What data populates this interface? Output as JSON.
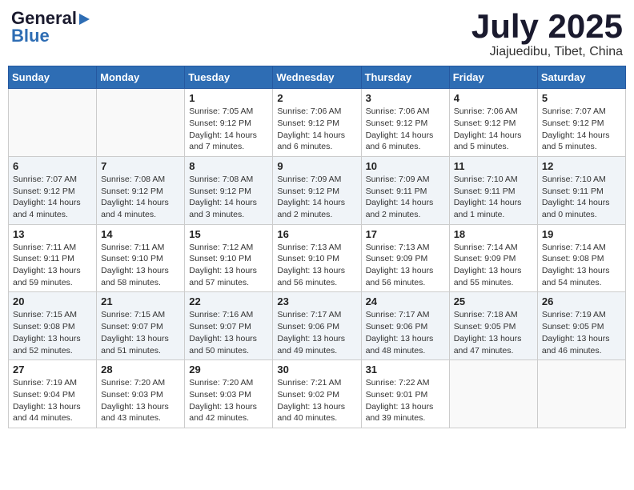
{
  "header": {
    "logo_general": "General",
    "logo_blue": "Blue",
    "month": "July 2025",
    "location": "Jiajuedibu, Tibet, China"
  },
  "days_of_week": [
    "Sunday",
    "Monday",
    "Tuesday",
    "Wednesday",
    "Thursday",
    "Friday",
    "Saturday"
  ],
  "weeks": [
    {
      "shaded": false,
      "days": [
        {
          "num": "",
          "info": ""
        },
        {
          "num": "",
          "info": ""
        },
        {
          "num": "1",
          "info": "Sunrise: 7:05 AM\nSunset: 9:12 PM\nDaylight: 14 hours and 7 minutes."
        },
        {
          "num": "2",
          "info": "Sunrise: 7:06 AM\nSunset: 9:12 PM\nDaylight: 14 hours and 6 minutes."
        },
        {
          "num": "3",
          "info": "Sunrise: 7:06 AM\nSunset: 9:12 PM\nDaylight: 14 hours and 6 minutes."
        },
        {
          "num": "4",
          "info": "Sunrise: 7:06 AM\nSunset: 9:12 PM\nDaylight: 14 hours and 5 minutes."
        },
        {
          "num": "5",
          "info": "Sunrise: 7:07 AM\nSunset: 9:12 PM\nDaylight: 14 hours and 5 minutes."
        }
      ]
    },
    {
      "shaded": true,
      "days": [
        {
          "num": "6",
          "info": "Sunrise: 7:07 AM\nSunset: 9:12 PM\nDaylight: 14 hours and 4 minutes."
        },
        {
          "num": "7",
          "info": "Sunrise: 7:08 AM\nSunset: 9:12 PM\nDaylight: 14 hours and 4 minutes."
        },
        {
          "num": "8",
          "info": "Sunrise: 7:08 AM\nSunset: 9:12 PM\nDaylight: 14 hours and 3 minutes."
        },
        {
          "num": "9",
          "info": "Sunrise: 7:09 AM\nSunset: 9:12 PM\nDaylight: 14 hours and 2 minutes."
        },
        {
          "num": "10",
          "info": "Sunrise: 7:09 AM\nSunset: 9:11 PM\nDaylight: 14 hours and 2 minutes."
        },
        {
          "num": "11",
          "info": "Sunrise: 7:10 AM\nSunset: 9:11 PM\nDaylight: 14 hours and 1 minute."
        },
        {
          "num": "12",
          "info": "Sunrise: 7:10 AM\nSunset: 9:11 PM\nDaylight: 14 hours and 0 minutes."
        }
      ]
    },
    {
      "shaded": false,
      "days": [
        {
          "num": "13",
          "info": "Sunrise: 7:11 AM\nSunset: 9:11 PM\nDaylight: 13 hours and 59 minutes."
        },
        {
          "num": "14",
          "info": "Sunrise: 7:11 AM\nSunset: 9:10 PM\nDaylight: 13 hours and 58 minutes."
        },
        {
          "num": "15",
          "info": "Sunrise: 7:12 AM\nSunset: 9:10 PM\nDaylight: 13 hours and 57 minutes."
        },
        {
          "num": "16",
          "info": "Sunrise: 7:13 AM\nSunset: 9:10 PM\nDaylight: 13 hours and 56 minutes."
        },
        {
          "num": "17",
          "info": "Sunrise: 7:13 AM\nSunset: 9:09 PM\nDaylight: 13 hours and 56 minutes."
        },
        {
          "num": "18",
          "info": "Sunrise: 7:14 AM\nSunset: 9:09 PM\nDaylight: 13 hours and 55 minutes."
        },
        {
          "num": "19",
          "info": "Sunrise: 7:14 AM\nSunset: 9:08 PM\nDaylight: 13 hours and 54 minutes."
        }
      ]
    },
    {
      "shaded": true,
      "days": [
        {
          "num": "20",
          "info": "Sunrise: 7:15 AM\nSunset: 9:08 PM\nDaylight: 13 hours and 52 minutes."
        },
        {
          "num": "21",
          "info": "Sunrise: 7:15 AM\nSunset: 9:07 PM\nDaylight: 13 hours and 51 minutes."
        },
        {
          "num": "22",
          "info": "Sunrise: 7:16 AM\nSunset: 9:07 PM\nDaylight: 13 hours and 50 minutes."
        },
        {
          "num": "23",
          "info": "Sunrise: 7:17 AM\nSunset: 9:06 PM\nDaylight: 13 hours and 49 minutes."
        },
        {
          "num": "24",
          "info": "Sunrise: 7:17 AM\nSunset: 9:06 PM\nDaylight: 13 hours and 48 minutes."
        },
        {
          "num": "25",
          "info": "Sunrise: 7:18 AM\nSunset: 9:05 PM\nDaylight: 13 hours and 47 minutes."
        },
        {
          "num": "26",
          "info": "Sunrise: 7:19 AM\nSunset: 9:05 PM\nDaylight: 13 hours and 46 minutes."
        }
      ]
    },
    {
      "shaded": false,
      "days": [
        {
          "num": "27",
          "info": "Sunrise: 7:19 AM\nSunset: 9:04 PM\nDaylight: 13 hours and 44 minutes."
        },
        {
          "num": "28",
          "info": "Sunrise: 7:20 AM\nSunset: 9:03 PM\nDaylight: 13 hours and 43 minutes."
        },
        {
          "num": "29",
          "info": "Sunrise: 7:20 AM\nSunset: 9:03 PM\nDaylight: 13 hours and 42 minutes."
        },
        {
          "num": "30",
          "info": "Sunrise: 7:21 AM\nSunset: 9:02 PM\nDaylight: 13 hours and 40 minutes."
        },
        {
          "num": "31",
          "info": "Sunrise: 7:22 AM\nSunset: 9:01 PM\nDaylight: 13 hours and 39 minutes."
        },
        {
          "num": "",
          "info": ""
        },
        {
          "num": "",
          "info": ""
        }
      ]
    }
  ]
}
